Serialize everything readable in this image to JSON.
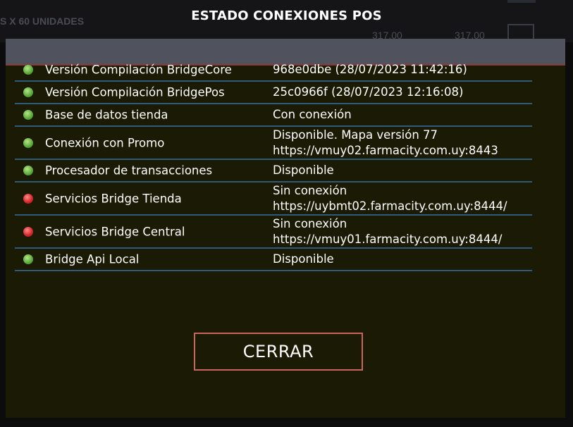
{
  "background": {
    "product_label": "S X 60 UNIDADES",
    "prices": [
      "317,00",
      "317,00"
    ]
  },
  "modal": {
    "title": "ESTADO CONEXIONES POS",
    "rows": [
      {
        "status": "ok",
        "label": "Versión Compilación BridgeCore",
        "value": [
          "968e0dbe (28/07/2023 11:42:16)"
        ]
      },
      {
        "status": "ok",
        "label": "Versión Compilación BridgePos",
        "value": [
          "25c0966f (28/07/2023 12:16:08)"
        ]
      },
      {
        "status": "ok",
        "label": "Base de datos tienda",
        "value": [
          "Con conexión"
        ]
      },
      {
        "status": "ok",
        "label": "Conexión con Promo",
        "value": [
          "Disponible. Mapa versión 77",
          "https://vmuy02.farmacity.com.uy:8443"
        ]
      },
      {
        "status": "ok",
        "label": "Procesador de transacciones",
        "value": [
          "Disponible"
        ]
      },
      {
        "status": "error",
        "label": "Servicios Bridge Tienda",
        "value": [
          "Sin conexión",
          "https://uybmt02.farmacity.com.uy:8444/"
        ]
      },
      {
        "status": "error",
        "label": "Servicios Bridge Central",
        "value": [
          "Sin conexión",
          "https://vmuy01.farmacity.com.uy:8444/"
        ]
      },
      {
        "status": "ok",
        "label": "Bridge Api Local",
        "value": [
          "Disponible"
        ]
      }
    ],
    "close_label": "CERRAR"
  },
  "colors": {
    "status_ok": "#5fae3d",
    "status_error": "#d72a2a",
    "row_divider": "#2e5a7c",
    "button_border": "#c9655a"
  }
}
